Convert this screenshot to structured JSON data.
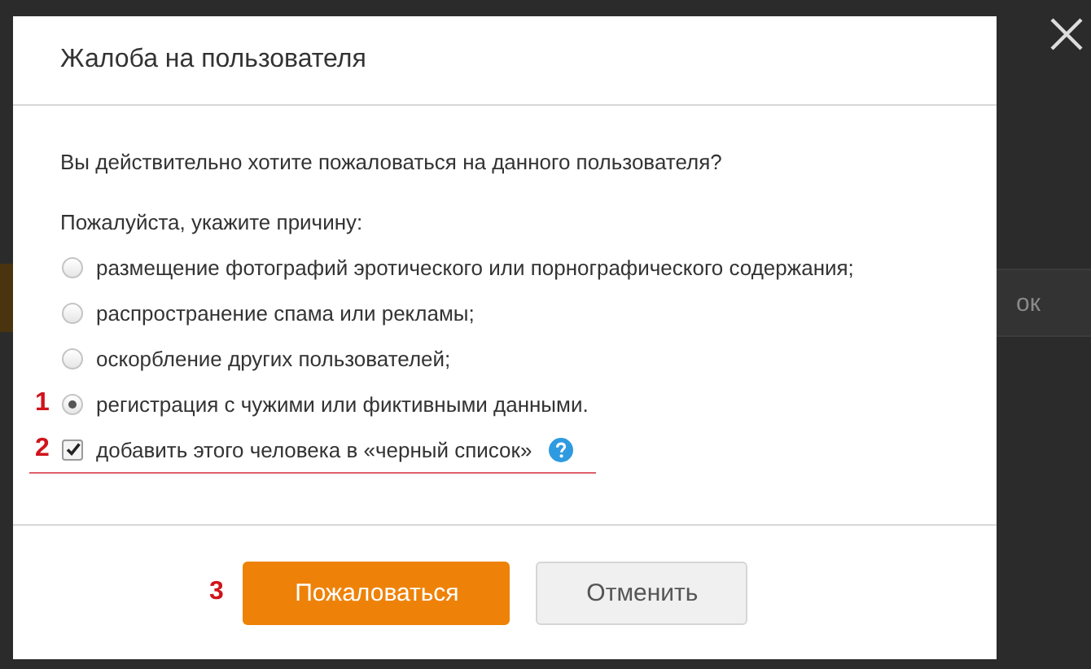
{
  "background": {
    "text": "ок"
  },
  "dialog": {
    "title": "Жалоба на пользователя",
    "question": "Вы действительно хотите пожаловаться на данного пользователя?",
    "prompt": "Пожалуйста, укажите причину:",
    "reasons": [
      {
        "label": "размещение фотографий эротического или порнографического содержания;",
        "selected": false
      },
      {
        "label": "распространение спама или рекламы;",
        "selected": false
      },
      {
        "label": "оскорбление других пользователей;",
        "selected": false
      },
      {
        "label": "регистрация с чужими или фиктивными данными.",
        "selected": true,
        "annotation": "1"
      }
    ],
    "blacklist": {
      "label": "добавить этого человека в «черный список»",
      "checked": true,
      "annotation": "2",
      "underlined": true
    },
    "buttons": [
      {
        "label": "Пожаловаться",
        "kind": "primary",
        "annotation": "3"
      },
      {
        "label": "Отменить",
        "kind": "secondary"
      }
    ]
  }
}
